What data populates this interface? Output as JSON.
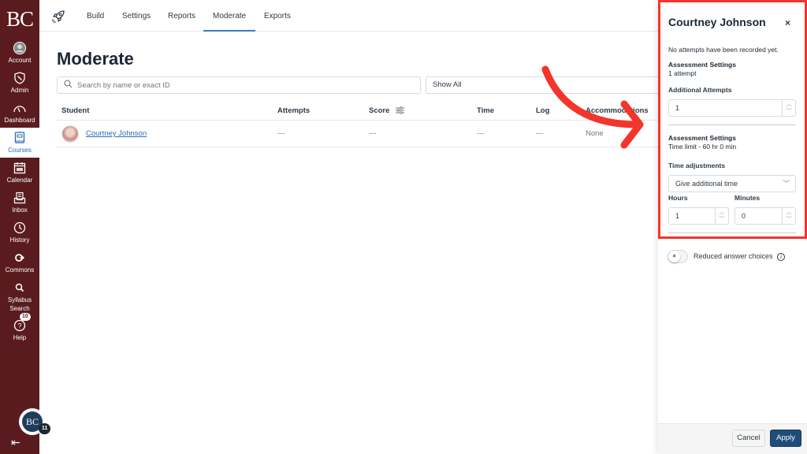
{
  "global_nav": {
    "logo": "BC",
    "items": [
      {
        "label": "Account",
        "icon": "account-icon"
      },
      {
        "label": "Admin",
        "icon": "admin-shield-icon"
      },
      {
        "label": "Dashboard",
        "icon": "dashboard-gauge-icon"
      },
      {
        "label": "Courses",
        "icon": "courses-book-icon",
        "active": true
      },
      {
        "label": "Calendar",
        "icon": "calendar-icon"
      },
      {
        "label": "Inbox",
        "icon": "inbox-icon"
      },
      {
        "label": "History",
        "icon": "history-clock-icon"
      },
      {
        "label": "Commons",
        "icon": "commons-icon"
      },
      {
        "label": "Syllabus Search",
        "icon": "syllabus-search-icon"
      },
      {
        "label": "Help",
        "icon": "help-icon",
        "badge": "10"
      }
    ],
    "user_avatar": "BC",
    "user_badge": "11",
    "collapse_icon": "collapse-nav-icon"
  },
  "top_nav": {
    "icon": "rocket-icon",
    "tabs": [
      {
        "label": "Build"
      },
      {
        "label": "Settings"
      },
      {
        "label": "Reports"
      },
      {
        "label": "Moderate",
        "active": true
      },
      {
        "label": "Exports"
      }
    ]
  },
  "main": {
    "title": "Moderate",
    "search_placeholder": "Search by name or exact ID",
    "filter_value": "Show All",
    "table": {
      "columns": [
        "Student",
        "Attempts",
        "Score",
        "Time",
        "Log",
        "Accommodations"
      ],
      "rows": [
        {
          "student": "Courtney Johnson",
          "attempts": "---",
          "score": "---",
          "time": "---",
          "log": "---",
          "accommodations": "None"
        }
      ]
    }
  },
  "tray": {
    "title": "Courtney Johnson",
    "close_label": "×",
    "no_attempts": "No attempts have been recorded yet.",
    "attempts_section": {
      "heading": "Assessment Settings",
      "detail": "1 attempt",
      "field_label": "Additional Attempts",
      "value": "1"
    },
    "time_section": {
      "heading": "Assessment Settings",
      "detail": "Time limit - 60 hr 0 min",
      "field_label": "Time adjustments",
      "select_value": "Give additional time",
      "hours_label": "Hours",
      "hours_value": "1",
      "minutes_label": "Minutes",
      "minutes_value": "0"
    },
    "reduced_choices": {
      "label": "Reduced answer choices",
      "enabled": false,
      "toggle_glyph": "×",
      "info": "i"
    },
    "footer": {
      "cancel": "Cancel",
      "apply": "Apply"
    }
  },
  "annotation": {
    "color": "#f4352b"
  },
  "colors": {
    "nav_bg": "#5a1b1f",
    "accent": "#2b6cb0",
    "apply_bg": "#1e4d7b"
  }
}
